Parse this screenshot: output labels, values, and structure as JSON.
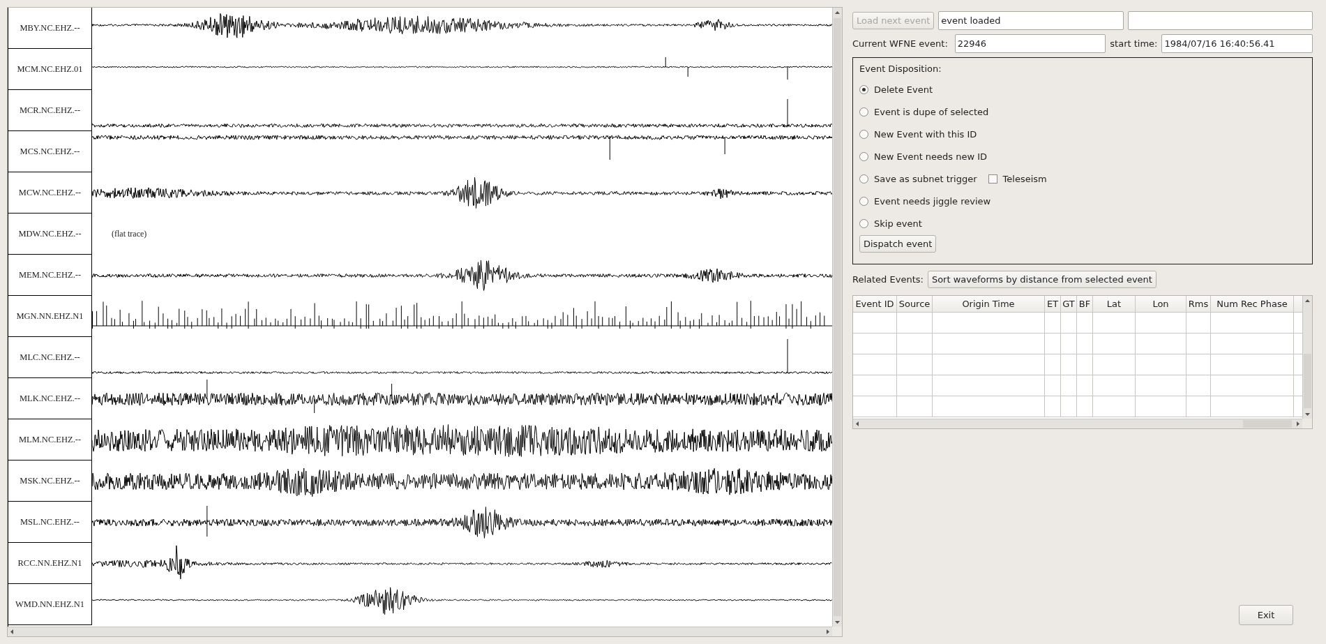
{
  "traces": [
    {
      "station": "MBY.NC.EHZ.--",
      "kind": "trace"
    },
    {
      "station": "MCM.NC.EHZ.01",
      "kind": "trace"
    },
    {
      "station": "MCR.NC.EHZ.--",
      "kind": "trace"
    },
    {
      "station": "MCS.NC.EHZ.--",
      "kind": "trace"
    },
    {
      "station": "MCW.NC.EHZ.--",
      "kind": "trace"
    },
    {
      "station": "MDW.NC.EHZ.--",
      "kind": "flat",
      "note": "(flat trace)"
    },
    {
      "station": "MEM.NC.EHZ.--",
      "kind": "trace"
    },
    {
      "station": "MGN.NN.EHZ.N1",
      "kind": "spikes"
    },
    {
      "station": "MLC.NC.EHZ.--",
      "kind": "trace"
    },
    {
      "station": "MLK.NC.EHZ.--",
      "kind": "trace"
    },
    {
      "station": "MLM.NC.EHZ.--",
      "kind": "trace"
    },
    {
      "station": "MSK.NC.EHZ.--",
      "kind": "trace"
    },
    {
      "station": "MSL.NC.EHZ.--",
      "kind": "trace"
    },
    {
      "station": "RCC.NN.EHZ.N1",
      "kind": "trace"
    },
    {
      "station": "WMD.NN.EHZ.N1",
      "kind": "trace"
    }
  ],
  "top_bar": {
    "load_button": {
      "label": "Load next event",
      "disabled": true
    },
    "status_field": {
      "value": "event loaded"
    }
  },
  "event_row": {
    "event_label": "Current WFNE event:",
    "event_field": {
      "value": "22946"
    },
    "start_label": "start time:",
    "start_field": {
      "value": "1984/07/16 16:40:56.41"
    }
  },
  "disposition": {
    "title": "Event Disposition:",
    "options": [
      {
        "label": "Delete Event",
        "selected": true
      },
      {
        "label": "Event is dupe of selected",
        "selected": false
      },
      {
        "label": "New Event with this ID",
        "selected": false
      },
      {
        "label": "New Event needs new ID",
        "selected": false
      },
      {
        "label": "Save as subnet trigger",
        "selected": false,
        "checkbox": {
          "label": "Teleseism",
          "checked": false
        }
      },
      {
        "label": "Event needs jiggle review",
        "selected": false
      },
      {
        "label": "Skip event",
        "selected": false
      }
    ],
    "dispatch_button": "Dispatch event"
  },
  "related": {
    "label": "Related Events:",
    "sort_button": "Sort waveforms by distance from selected event"
  },
  "table": {
    "columns": [
      "Event ID",
      "Source",
      "Origin Time",
      "ET",
      "GT",
      "BF",
      "Lat",
      "Lon",
      "Rms",
      "Num Rec Phase"
    ]
  },
  "exit_button": "Exit"
}
